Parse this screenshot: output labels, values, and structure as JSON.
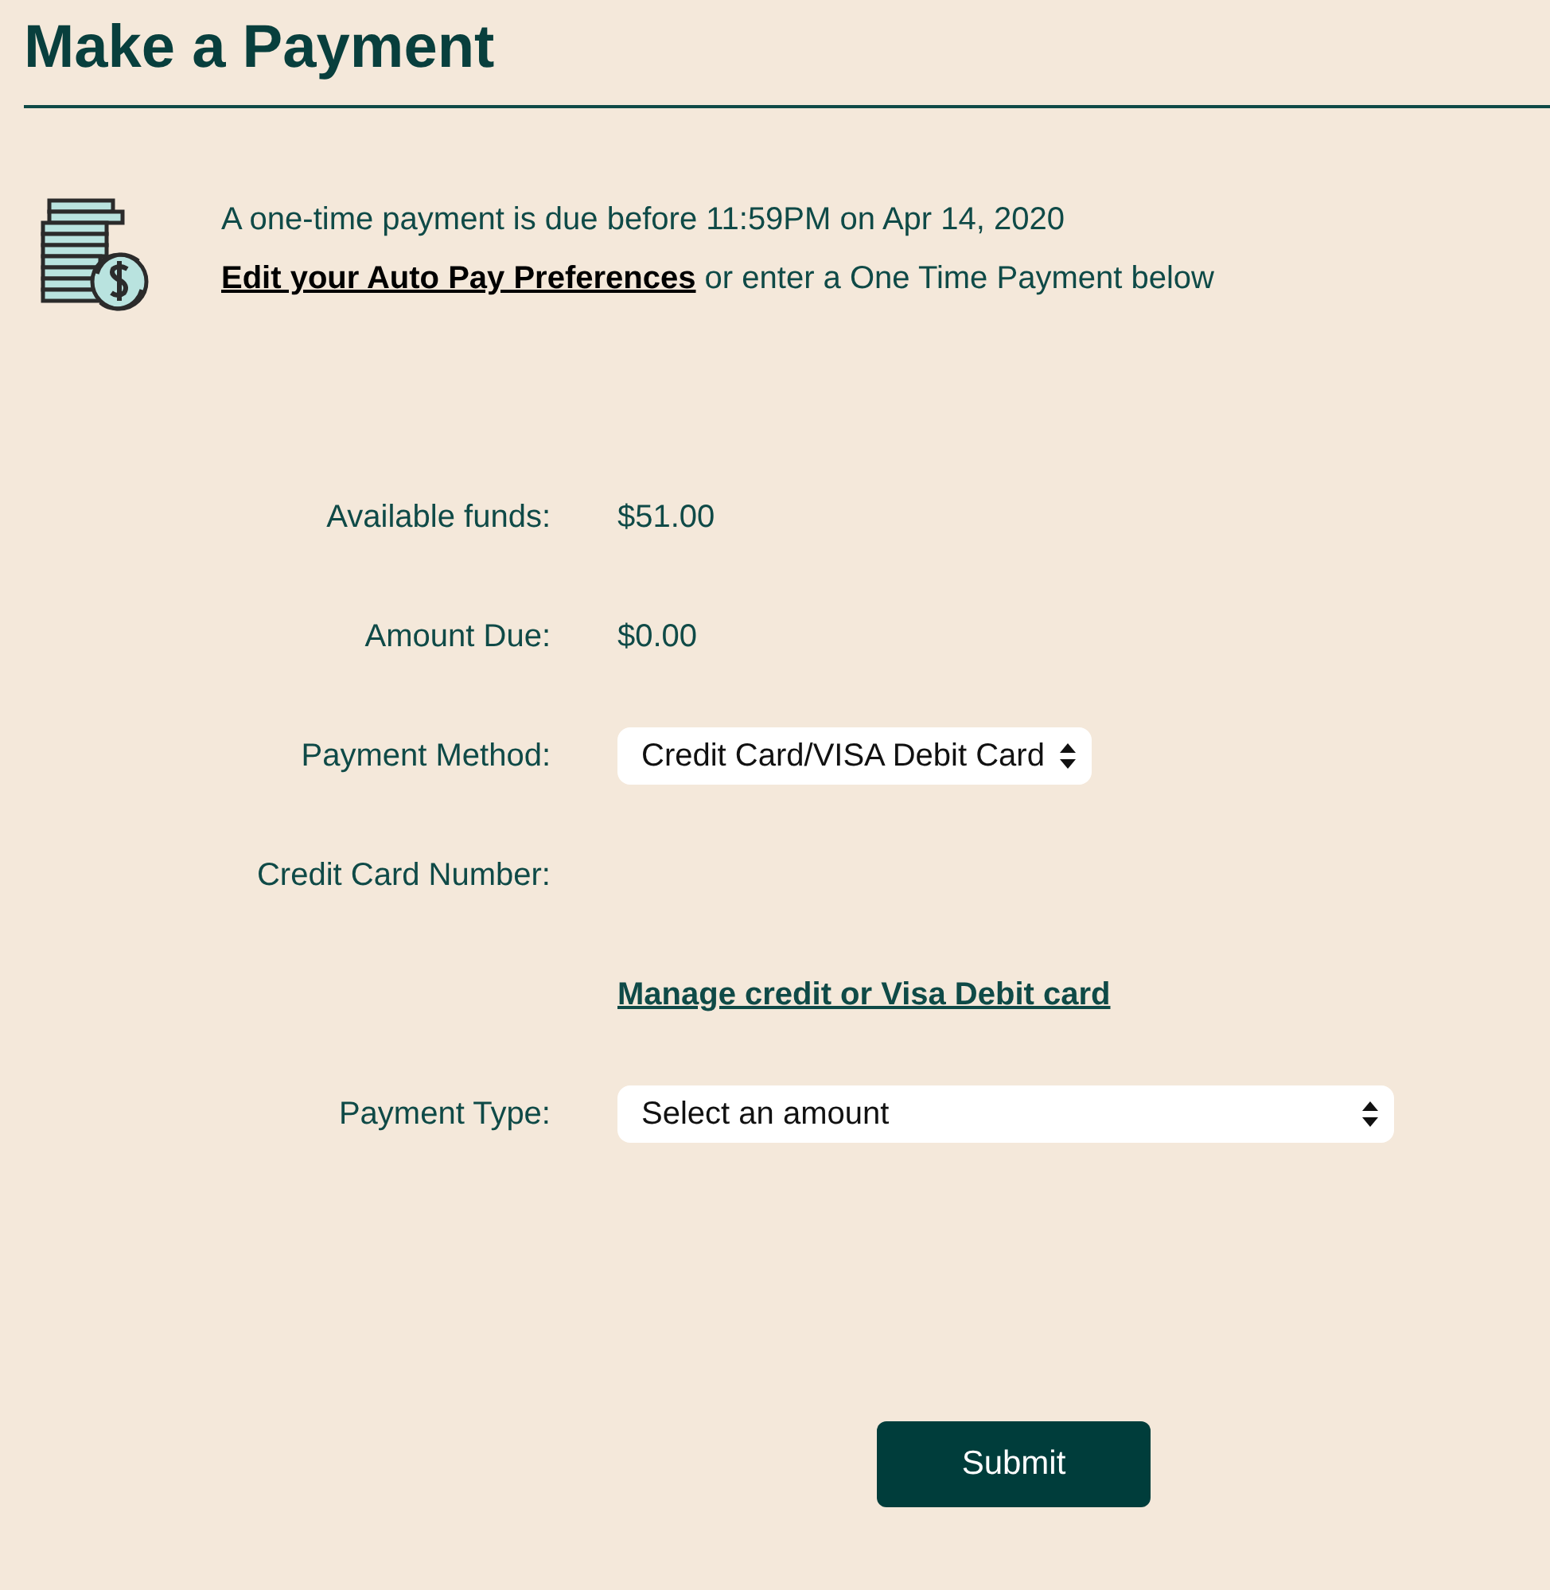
{
  "title": "Make a Payment",
  "notice": {
    "text": "A one-time payment is due before 11:59PM on Apr 14, 2020",
    "link": "Edit your Auto Pay Preferences",
    "rest": "or enter a One Time Payment below"
  },
  "rows": [
    {
      "kind": "text",
      "label": "Available funds:",
      "value": "$51.00"
    },
    {
      "kind": "text",
      "label": "Amount Due:",
      "value": "$0.00"
    },
    {
      "kind": "select",
      "label": "Payment Method:",
      "value": "Credit Card/VISA Debit Card"
    },
    {
      "kind": "empty",
      "label": "Credit Card Number:"
    },
    {
      "kind": "link",
      "value": "Manage credit or Visa Debit card"
    },
    {
      "kind": "select",
      "label": "Payment Type:",
      "placeholder": "Select an amount"
    }
  ],
  "submit": "Submit"
}
